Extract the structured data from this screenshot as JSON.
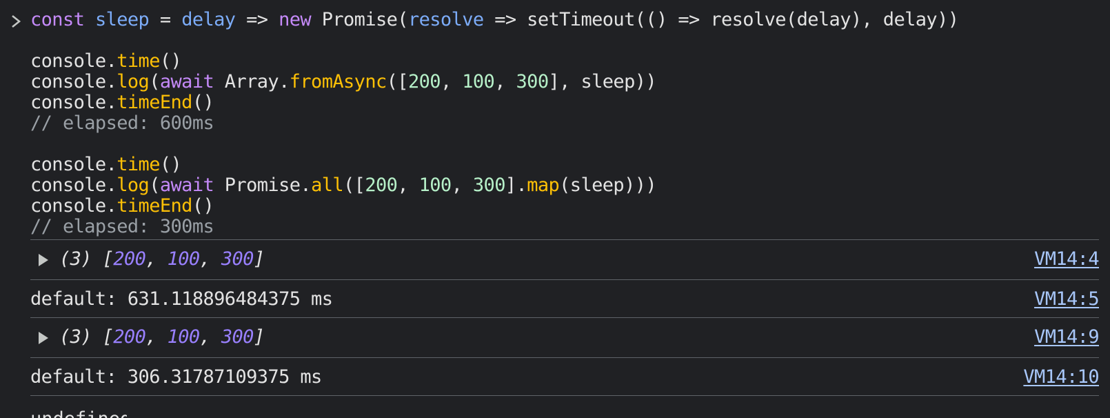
{
  "console": {
    "code_lines": [
      [
        {
          "t": "const",
          "c": "kw"
        },
        {
          "t": " ",
          "c": "plain"
        },
        {
          "t": "sleep",
          "c": "var"
        },
        {
          "t": " = ",
          "c": "op"
        },
        {
          "t": "delay",
          "c": "var"
        },
        {
          "t": " => ",
          "c": "op"
        },
        {
          "t": "new",
          "c": "kw"
        },
        {
          "t": " Promise(",
          "c": "plain"
        },
        {
          "t": "resolve",
          "c": "var"
        },
        {
          "t": " => setTimeout(() => resolve(delay), delay))",
          "c": "plain"
        }
      ],
      [],
      [
        {
          "t": "console.",
          "c": "plain"
        },
        {
          "t": "time",
          "c": "fn"
        },
        {
          "t": "()",
          "c": "plain"
        }
      ],
      [
        {
          "t": "console.",
          "c": "plain"
        },
        {
          "t": "log",
          "c": "fn"
        },
        {
          "t": "(",
          "c": "plain"
        },
        {
          "t": "await",
          "c": "kw"
        },
        {
          "t": " Array.",
          "c": "plain"
        },
        {
          "t": "fromAsync",
          "c": "fn"
        },
        {
          "t": "([",
          "c": "plain"
        },
        {
          "t": "200",
          "c": "num"
        },
        {
          "t": ", ",
          "c": "plain"
        },
        {
          "t": "100",
          "c": "num"
        },
        {
          "t": ", ",
          "c": "plain"
        },
        {
          "t": "300",
          "c": "num"
        },
        {
          "t": "], sleep))",
          "c": "plain"
        }
      ],
      [
        {
          "t": "console.",
          "c": "plain"
        },
        {
          "t": "timeEnd",
          "c": "fn"
        },
        {
          "t": "()",
          "c": "plain"
        }
      ],
      [
        {
          "t": "// elapsed: 600ms",
          "c": "comment"
        }
      ],
      [],
      [
        {
          "t": "console.",
          "c": "plain"
        },
        {
          "t": "time",
          "c": "fn"
        },
        {
          "t": "()",
          "c": "plain"
        }
      ],
      [
        {
          "t": "console.",
          "c": "plain"
        },
        {
          "t": "log",
          "c": "fn"
        },
        {
          "t": "(",
          "c": "plain"
        },
        {
          "t": "await",
          "c": "kw"
        },
        {
          "t": " Promise.",
          "c": "plain"
        },
        {
          "t": "all",
          "c": "fn"
        },
        {
          "t": "([",
          "c": "plain"
        },
        {
          "t": "200",
          "c": "num"
        },
        {
          "t": ", ",
          "c": "plain"
        },
        {
          "t": "100",
          "c": "num"
        },
        {
          "t": ", ",
          "c": "plain"
        },
        {
          "t": "300",
          "c": "num"
        },
        {
          "t": "].",
          "c": "plain"
        },
        {
          "t": "map",
          "c": "fn"
        },
        {
          "t": "(sleep)))",
          "c": "plain"
        }
      ],
      [
        {
          "t": "console.",
          "c": "plain"
        },
        {
          "t": "timeEnd",
          "c": "fn"
        },
        {
          "t": "()",
          "c": "plain"
        }
      ],
      [
        {
          "t": "// elapsed: 300ms",
          "c": "comment"
        }
      ]
    ],
    "messages": [
      {
        "type": "array",
        "prefix": "(3) [",
        "values": [
          "200",
          "100",
          "300"
        ],
        "sep": ", ",
        "suffix": "]",
        "source": "VM14:4"
      },
      {
        "type": "log",
        "text": "default: 631.118896484375 ms",
        "source": "VM14:5"
      },
      {
        "type": "array",
        "prefix": "(3) [",
        "values": [
          "200",
          "100",
          "300"
        ],
        "sep": ", ",
        "suffix": "]",
        "source": "VM14:9"
      },
      {
        "type": "log",
        "text": "default: 306.31787109375 ms",
        "source": "VM14:10"
      }
    ],
    "partial_next": "undefined"
  },
  "colors": {
    "background": "#202124",
    "keyword": "#c58af9",
    "variable": "#7cacf8",
    "function": "#fdc006",
    "number": "#b6f0c8",
    "array_number": "#9980ff",
    "link": "#a8c7fa",
    "divider": "#5f6368"
  },
  "icons": {
    "prompt": "chevron-right-icon",
    "expand": "expand-triangle-icon"
  }
}
